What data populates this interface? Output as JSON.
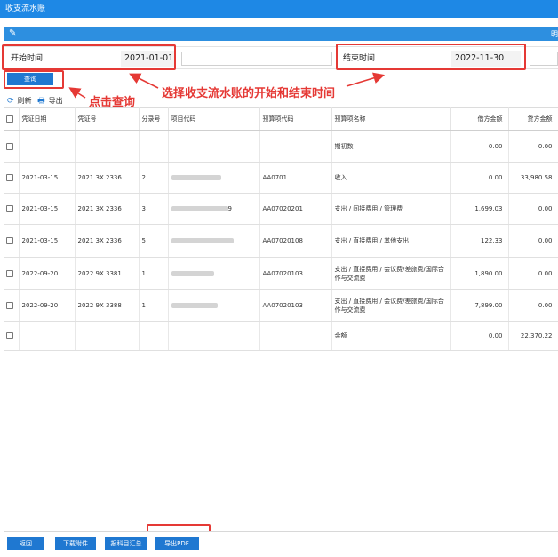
{
  "window": {
    "title": "收支流水账",
    "right_text": "明"
  },
  "filter": {
    "start_label": "开始时间",
    "start_value": "2021-01-01",
    "end_label": "结束时间",
    "end_value": "2022-11-30"
  },
  "toolbar": {
    "query_label": "查询",
    "refresh_label": "刷新",
    "export_label": "导出"
  },
  "annotations": {
    "click_query": "点击查询",
    "select_range": "选择收支流水账的开始和结束时间"
  },
  "table": {
    "columns": [
      "凭证日期",
      "凭证号",
      "分录号",
      "项目代码",
      "预算项代码",
      "预算项名称",
      "借方金额",
      "贷方金额"
    ],
    "rows": [
      {
        "date": "",
        "voucher": "",
        "entry": "",
        "project": "",
        "budget_code": "",
        "budget_name": "期初数",
        "debit": "0.00",
        "credit": "0.00"
      },
      {
        "date": "2021-03-15",
        "voucher": "2021 3X  2336",
        "entry": "2",
        "project": "",
        "budget_code": "AA0701",
        "budget_name": "收入",
        "debit": "0.00",
        "credit": "33,980.58"
      },
      {
        "date": "2021-03-15",
        "voucher": "2021 3X  2336",
        "entry": "3",
        "project": "9",
        "budget_code": "AA07020201",
        "budget_name": "支出 / 间接费用 / 管理费",
        "debit": "1,699.03",
        "credit": "0.00"
      },
      {
        "date": "2021-03-15",
        "voucher": "2021 3X  2336",
        "entry": "5",
        "project": "",
        "budget_code": "AA07020108",
        "budget_name": "支出 / 直接费用 / 其他支出",
        "debit": "122.33",
        "credit": "0.00"
      },
      {
        "date": "2022-09-20",
        "voucher": "2022 9X  3381",
        "entry": "1",
        "project": "",
        "budget_code": "AA07020103",
        "budget_name": "支出 / 直接费用 / 会议费/差旅费/国际合作与交流费",
        "debit": "1,890.00",
        "credit": "0.00"
      },
      {
        "date": "2022-09-20",
        "voucher": "2022 9X  3388",
        "entry": "1",
        "project": "",
        "budget_code": "AA07020103",
        "budget_name": "支出 / 直接费用 / 会议费/差旅费/国际合作与交流费",
        "debit": "7,899.00",
        "credit": "0.00"
      },
      {
        "date": "",
        "voucher": "",
        "entry": "",
        "project": "",
        "budget_code": "",
        "budget_name": "余额",
        "debit": "0.00",
        "credit": "22,370.22"
      }
    ]
  },
  "bottom": {
    "back_label": "返回",
    "download_label": "下载附件",
    "report_label": "报科目汇总",
    "pdf_label": "导出PDF"
  }
}
